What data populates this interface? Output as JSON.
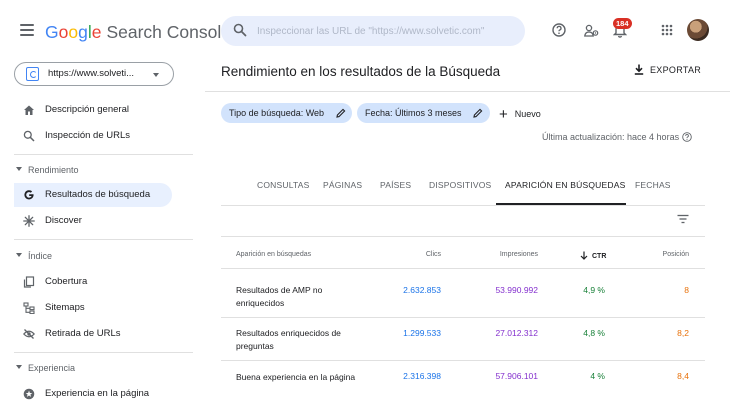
{
  "app": {
    "logo_google": [
      "G",
      "o",
      "o",
      "g",
      "l",
      "e"
    ],
    "logo_product": "Search Console",
    "search_placeholder": "Inspeccionar las URL de \"https://www.solvetic.com\"",
    "notification_count": "184",
    "colors": {
      "google_blue": "#4285f4",
      "google_red": "#ea4335",
      "google_yellow": "#fbbc05",
      "google_green": "#34a853",
      "accent": "#1a73e8",
      "chip_bg": "#d2e3fc",
      "active_nav_bg": "#e8f0fe"
    }
  },
  "sidebar": {
    "property": "https://www.solveti...",
    "items_top": [
      {
        "label": "Descripción general",
        "icon": "home-icon"
      },
      {
        "label": "Inspección de URLs",
        "icon": "search-icon"
      }
    ],
    "section_rendimiento": "Rendimiento",
    "items_rendimiento": [
      {
        "label": "Resultados de búsqueda",
        "icon": "google-g-icon",
        "active": true
      },
      {
        "label": "Discover",
        "icon": "asterisk-icon"
      }
    ],
    "section_indice": "Índice",
    "items_indice": [
      {
        "label": "Cobertura",
        "icon": "copy-icon"
      },
      {
        "label": "Sitemaps",
        "icon": "sitemap-icon"
      },
      {
        "label": "Retirada de URLs",
        "icon": "eye-off-icon"
      }
    ],
    "section_experiencia": "Experiencia",
    "items_experiencia": [
      {
        "label": "Experiencia en la página",
        "icon": "star-circle-icon"
      }
    ]
  },
  "main": {
    "title": "Rendimiento en los resultados de la Búsqueda",
    "export_label": "EXPORTAR",
    "chips": [
      {
        "label": "Tipo de búsqueda: Web"
      },
      {
        "label": "Fecha: Últimos 3 meses"
      }
    ],
    "new_label": "Nuevo",
    "last_update": "Última actualización: hace 4 horas",
    "tabs": [
      "CONSULTAS",
      "PÁGINAS",
      "PAÍSES",
      "DISPOSITIVOS",
      "APARICIÓN EN BÚSQUEDAS",
      "FECHAS"
    ],
    "active_tab": "APARICIÓN EN BÚSQUEDAS",
    "table": {
      "headers": [
        "Aparición en búsquedas",
        "Clics",
        "Impresiones",
        "CTR",
        "Posición"
      ],
      "sorted_by": "CTR",
      "rows": [
        {
          "label": "Resultados de AMP no enriquecidos",
          "clicks": "2.632.853",
          "impressions": "53.990.992",
          "ctr": "4,9 %",
          "position": "8"
        },
        {
          "label": "Resultados enriquecidos de preguntas",
          "clicks": "1.299.533",
          "impressions": "27.012.312",
          "ctr": "4,8 %",
          "position": "8,2"
        },
        {
          "label": "Buena experiencia en la página",
          "clicks": "2.316.398",
          "impressions": "57.906.101",
          "ctr": "4 %",
          "position": "8,4"
        }
      ]
    }
  }
}
